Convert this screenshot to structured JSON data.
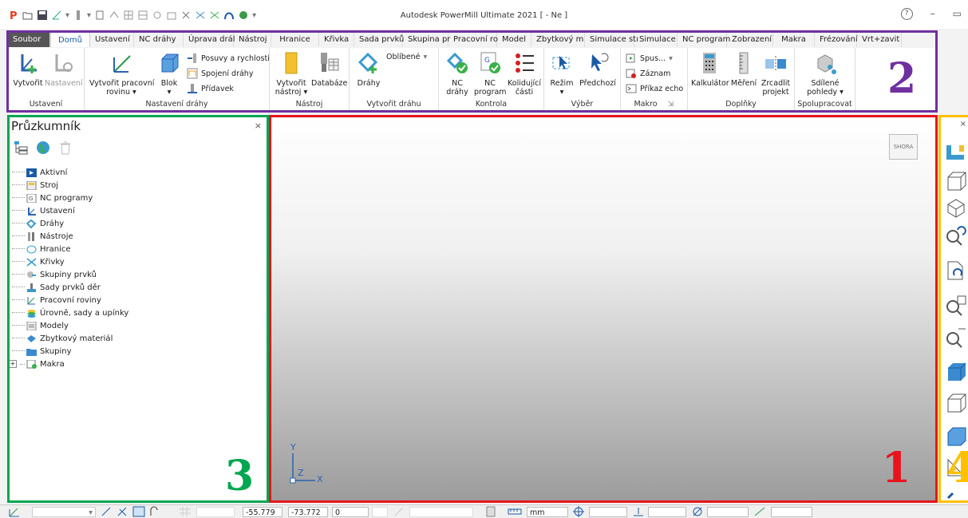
{
  "window": {
    "title": "Autodesk PowerMill Ultimate 2021   [ - Ne ]",
    "help": "?",
    "minimize": "–",
    "restore": "▭"
  },
  "tabs": [
    "Soubor",
    "Domů",
    "Ustavení",
    "NC dráhy",
    "Úprava drál",
    "Nástroj",
    "Hranice",
    "Křivka",
    "Sada prvků",
    "Skupina pr",
    "Pracovní ro",
    "Model",
    "Zbytkový m",
    "Simulace stı",
    "Simulace",
    "NC program",
    "Zobrazení",
    "Makra",
    "Frézování",
    "Vrt+zavit"
  ],
  "ribbon": {
    "ustaveni": {
      "label": "Ustavení",
      "create": "Vytvořit",
      "settings": "Nastavení"
    },
    "nastaveni_drahy": {
      "label": "Nastavení dráhy",
      "create_plane": "Vytvořit pracovní",
      "create_plane2": "rovinu",
      "block": "Blok",
      "feeds": "Posuvy a rychlosti",
      "links": "Spojení dráhy",
      "allowance": "Přídavek"
    },
    "nastroj": {
      "label": "Nástroj",
      "create_tool": "Vytvořit",
      "create_tool2": "nástroj",
      "database": "Databáze"
    },
    "vytvorit_drahu": {
      "label": "Vytvořit dráhu",
      "toolpaths": "Dráhy",
      "favorites": "Oblíbené"
    },
    "kontrola": {
      "label": "Kontrola",
      "nc_paths": "NC",
      "nc_paths2": "dráhy",
      "nc_program": "NC",
      "nc_program2": "program",
      "collision": "Kolidující",
      "collision2": "části"
    },
    "vyber": {
      "label": "Výběr",
      "mode": "Režim",
      "previous": "Předchozí"
    },
    "makro": {
      "label": "Makro",
      "run": "Spus...",
      "record": "Záznam",
      "echo": "Příkaz echo"
    },
    "doplnky": {
      "label": "Doplňky",
      "calculator": "Kalkulátor",
      "measure": "Měření",
      "mirror": "Zrcadlit",
      "mirror2": "projekt"
    },
    "spolupracovat": {
      "label": "Spolupracovat",
      "shared": "Sdílené",
      "shared2": "pohledy"
    }
  },
  "annotations": {
    "viewport": "1",
    "ribbon": "2",
    "explorer": "3",
    "toolbar": "4"
  },
  "explorer": {
    "title": "Průzkumník",
    "close": "×",
    "items": [
      "Aktivní",
      "Stroj",
      "NC programy",
      "Ustavení",
      "Dráhy",
      "Nástroje",
      "Hranice",
      "Křivky",
      "Skupiny prvků",
      "Sady prvků děr",
      "Pracovní roviny",
      "Úrovně, sady a upínky",
      "Modely",
      "Zbytkový materiál",
      "Skupiny",
      "Makra"
    ]
  },
  "viewport": {
    "viewcube": "SHORA",
    "axis_y": "Y",
    "axis_z": "Z",
    "axis_x": "X"
  },
  "status": {
    "x": "-55.779",
    "y": "-73.772",
    "z": "0",
    "units": "mm"
  },
  "colors": {
    "viewport_box": "#e8141c",
    "ribbon_box": "#7030a0",
    "explorer_box": "#00a651",
    "toolbar_box": "#ffc000",
    "annotation_ribbon": "#7030a0"
  }
}
